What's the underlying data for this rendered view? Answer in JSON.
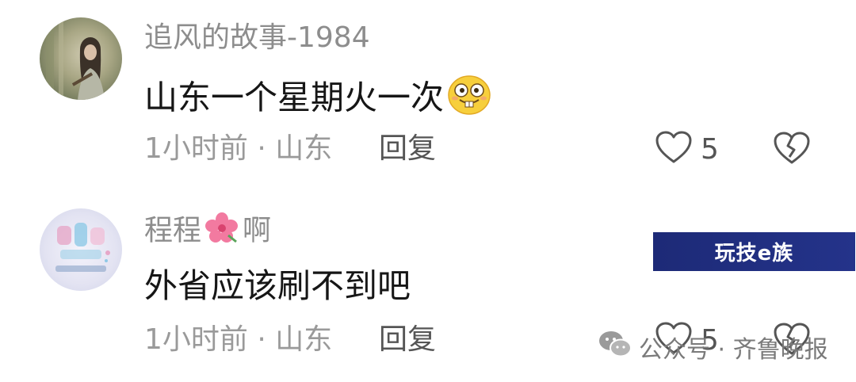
{
  "comments": [
    {
      "username": "追风的故事-1984",
      "avatar_icon": "avatar-photo-girl",
      "content": "山东一个星期火一次",
      "content_emoji": "grinning-buck-teeth-emoji",
      "time": "1小时前",
      "separator": "·",
      "location": "山东",
      "reply_label": "回复",
      "like_count": "5"
    },
    {
      "username_prefix": "程程",
      "username_suffix": "啊",
      "name_emoji": "hibiscus-emoji",
      "avatar_icon": "avatar-text-art",
      "content": "外省应该刷不到吧",
      "time": "1小时前",
      "separator": "·",
      "location": "山东",
      "reply_label": "回复",
      "like_count": "5"
    }
  ],
  "ad": {
    "text": "玩技e族"
  },
  "watermark": {
    "text": "公众号 · 齐鲁晚报",
    "icon": "wechat-icon"
  },
  "colors": {
    "username": "#8d8d8d",
    "content": "#161616",
    "meta": "#9a9a9a",
    "ad_background": "#1d2a77"
  }
}
